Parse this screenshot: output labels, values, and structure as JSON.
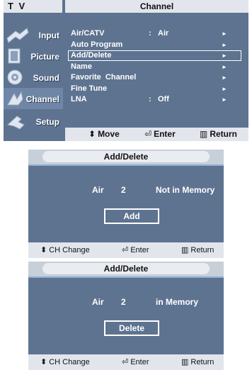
{
  "tv_menu": {
    "title": "T V",
    "header": "Channel",
    "sidebar": [
      {
        "label": "Input",
        "icon": "input-icon"
      },
      {
        "label": "Picture",
        "icon": "picture-icon"
      },
      {
        "label": "Sound",
        "icon": "sound-icon"
      },
      {
        "label": "Channel",
        "icon": "channel-icon",
        "active": true
      },
      {
        "label": "Setup",
        "icon": "setup-icon"
      }
    ],
    "items": [
      {
        "label": "Air/CATV",
        "sep": ":",
        "value": "Air",
        "arrow": "►"
      },
      {
        "label": "Auto Program",
        "sep": "",
        "value": "",
        "arrow": "►"
      },
      {
        "label": "Add/Delete",
        "sep": "",
        "value": "",
        "arrow": "►",
        "selected": true
      },
      {
        "label": "Name",
        "sep": "",
        "value": "",
        "arrow": "►"
      },
      {
        "label": "Favorite  Channel",
        "sep": "",
        "value": "",
        "arrow": "►"
      },
      {
        "label": "Fine Tune",
        "sep": "",
        "value": "",
        "arrow": "►"
      },
      {
        "label": "LNA",
        "sep": ":",
        "value": "Off",
        "arrow": "►"
      }
    ],
    "hints": {
      "move_icon": "⬍",
      "move": "Move",
      "enter_icon": "⏎",
      "enter": "Enter",
      "return_icon": "▥",
      "return": "Return"
    }
  },
  "dialogs": [
    {
      "title": "Add/Delete",
      "source": "Air",
      "channel": "2",
      "status": "Not in Memory",
      "button": "Add",
      "footer": {
        "ch_icon": "⬍",
        "ch": "CH Change",
        "enter_icon": "⏎",
        "enter": "Enter",
        "return_icon": "▥",
        "return": "Return"
      }
    },
    {
      "title": "Add/Delete",
      "source": "Air",
      "channel": "2",
      "status": "in Memory",
      "button": "Delete",
      "footer": {
        "ch_icon": "⬍",
        "ch": "CH Change",
        "enter_icon": "⏎",
        "enter": "Enter",
        "return_icon": "▥",
        "return": "Return"
      }
    }
  ],
  "colors": {
    "panel": "#5d7390",
    "bar": "#e2e6ec",
    "accent_line": "#8fb0d4"
  }
}
